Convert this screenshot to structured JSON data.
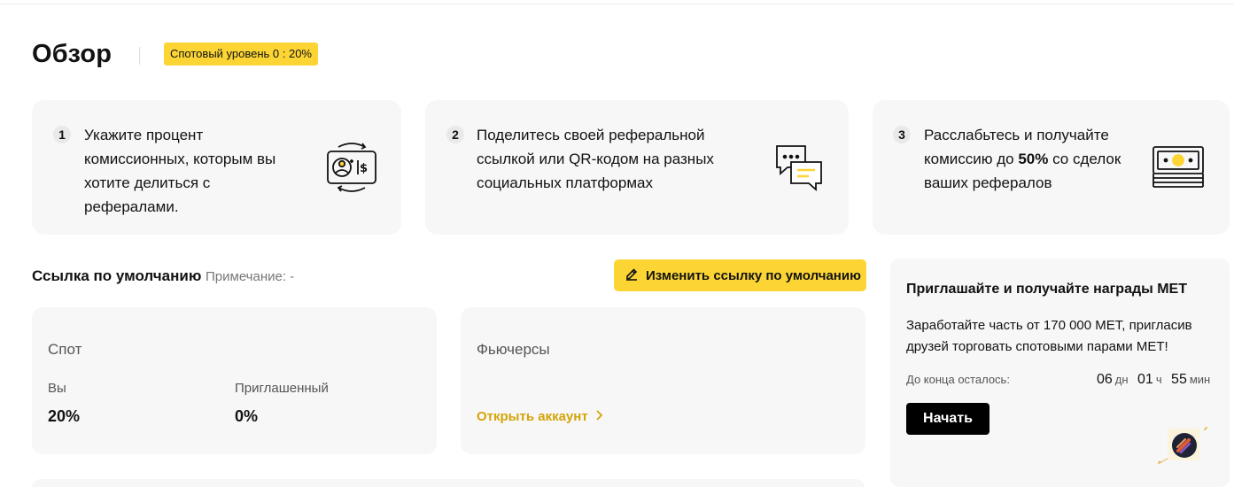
{
  "header": {
    "title": "Обзор",
    "level_badge": "Спотовый уровень 0 : 20%"
  },
  "steps": [
    {
      "num": "1",
      "text": "Укажите процент комиссионных, которым вы хотите делиться с рефералами.",
      "icon": "percent-exchange-icon"
    },
    {
      "num": "2",
      "text": "Поделитесь своей реферальной ссылкой или QR-кодом на разных социальных платформах",
      "icon": "chat-bubbles-icon"
    },
    {
      "num": "3",
      "text_before": "Расслабьтесь и получайте комиссию до ",
      "text_bold": "50%",
      "text_after": " со сделок ваших рефералов",
      "icon": "money-stack-icon"
    }
  ],
  "default_link": {
    "title": "Ссылка по умолчанию",
    "note": "Примечание: -",
    "edit_button": "Изменить ссылку по умолчанию"
  },
  "spot": {
    "title": "Спот",
    "you_label": "Вы",
    "you_value": "20%",
    "invited_label": "Приглашенный",
    "invited_value": "0%"
  },
  "futures": {
    "title": "Фьючерсы",
    "open_link": "Открыть аккаунт"
  },
  "promo": {
    "title": "Приглашайте и получайте награды MET",
    "text": "Заработайте часть от 170 000 MET, пригласив друзей торговать спотовыми парами MET!",
    "time_left_label": "До конца осталось:",
    "days": "06",
    "days_unit": "дн",
    "hours": "01",
    "hours_unit": "ч",
    "minutes": "55",
    "minutes_unit": "мин",
    "start_button": "Начать"
  },
  "colors": {
    "accent": "#fcd535",
    "link": "#d4a407",
    "card_bg": "#f7f7f7"
  }
}
